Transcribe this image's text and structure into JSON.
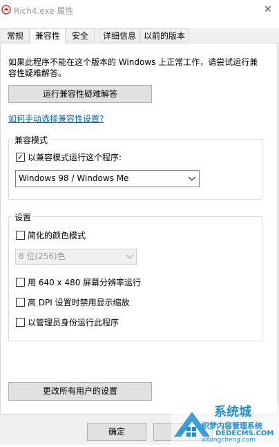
{
  "window": {
    "title": "Rich4.exe 属性",
    "close_glyph": "✕"
  },
  "tabs": [
    {
      "label": "常规",
      "active": false
    },
    {
      "label": "兼容性",
      "active": true
    },
    {
      "label": "安全",
      "active": false
    },
    {
      "label": "详细信息",
      "active": false
    },
    {
      "label": "以前的版本",
      "active": false
    }
  ],
  "compat": {
    "intro_line1": "如果此程序不能在这个版本的 Windows 上正常工作，请尝试运行兼",
    "intro_line2": "容性疑难解答。",
    "troubleshooter_button": "运行兼容性疑难解答",
    "manual_link": "如何手动选择兼容性设置?"
  },
  "compat_mode": {
    "legend": "兼容模式",
    "checkbox_label": "以兼容模式运行这个程序:",
    "checked": true,
    "check_glyph": "✓",
    "selected_os": "Windows 98 / Windows Me"
  },
  "settings": {
    "legend": "设置",
    "reduced_color_label": "简化的颜色模式",
    "reduced_color_checked": false,
    "color_depth_value": "8 位(256)色",
    "resolution_label": "用 640 x 480 屏幕分辨率运行",
    "resolution_checked": false,
    "dpi_label": "高 DPI 设置时禁用显示缩放",
    "dpi_checked": false,
    "admin_label": "以管理员身份运行此程序",
    "admin_checked": false
  },
  "all_users_button": "更改所有用户的设置",
  "footer": {
    "ok_button": "确定",
    "cancel_button": "取"
  },
  "watermark": {
    "brand_text": "系统城",
    "line1": "织梦内容管理系统",
    "line2": "DEDECMS.COM",
    "site": "xitongcheng.com"
  },
  "colors": {
    "link": "#0066cc",
    "watermark_blue": "#1a8fd6"
  }
}
